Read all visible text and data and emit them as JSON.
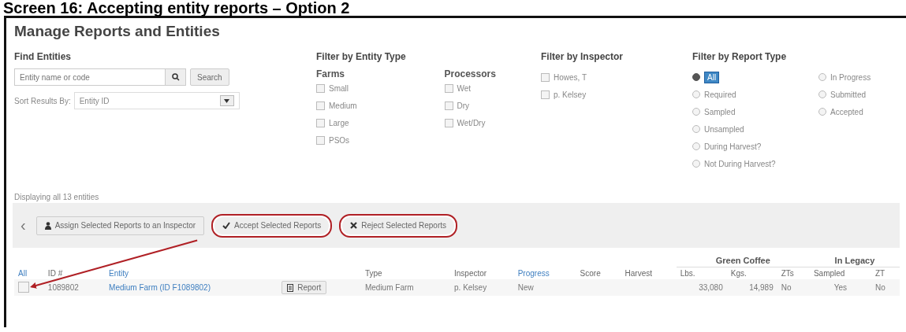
{
  "heading": "Screen 16: Accepting entity reports – Option 2",
  "page_title": "Manage Reports and Entities",
  "find": {
    "label": "Find Entities",
    "placeholder": "Entity name or code",
    "search_button": "Search",
    "sort_label": "Sort Results By:",
    "sort_value": "Entity ID",
    "count": "Displaying all 13 entities"
  },
  "entity_filter": {
    "label": "Filter by Entity Type",
    "groups": [
      {
        "label": "Farms",
        "items": [
          {
            "label": "Small",
            "checked": false
          },
          {
            "label": "Medium",
            "checked": false
          },
          {
            "label": "Large",
            "checked": false
          },
          {
            "label": "PSOs",
            "checked": false
          }
        ]
      },
      {
        "label": "Processors",
        "items": [
          {
            "label": "Wet",
            "checked": false
          },
          {
            "label": "Dry",
            "checked": false
          },
          {
            "label": "Wet/Dry",
            "checked": false
          }
        ]
      }
    ]
  },
  "inspector_filter": {
    "label": "Filter by Inspector",
    "items": [
      {
        "label": "Howes, T",
        "checked": false
      },
      {
        "label": "p. Kelsey",
        "checked": false
      }
    ]
  },
  "report_filter": {
    "label": "Filter by Report Type",
    "columns": [
      [
        {
          "label": "All",
          "selected": true
        },
        {
          "label": "Required",
          "selected": false
        },
        {
          "label": "Sampled",
          "selected": false
        },
        {
          "label": "Unsampled",
          "selected": false
        },
        {
          "label": "During Harvest?",
          "selected": false
        },
        {
          "label": "Not During Harvest?",
          "selected": false
        }
      ],
      [
        {
          "label": "In Progress",
          "selected": false
        },
        {
          "label": "Submitted",
          "selected": false
        },
        {
          "label": "Accepted",
          "selected": false
        }
      ]
    ]
  },
  "toolbar": {
    "back": "‹",
    "buttons": [
      {
        "kind": "assign",
        "label": "Assign Selected Reports to an Inspector",
        "highlighted": false
      },
      {
        "kind": "accept",
        "label": "Accept Selected Reports",
        "highlighted": true
      },
      {
        "kind": "reject",
        "label": "Reject Selected Reports",
        "highlighted": true
      }
    ]
  },
  "table": {
    "groups": [
      {
        "label": "Green Coffee"
      },
      {
        "label": "In Legacy"
      }
    ],
    "columns": [
      {
        "label": "All",
        "link": true
      },
      {
        "label": "ID #",
        "link": false
      },
      {
        "label": "Entity",
        "link": true
      },
      {},
      {
        "label": "Type",
        "link": false
      },
      {
        "label": "Inspector",
        "link": false
      },
      {
        "label": "Progress",
        "link": true
      },
      {
        "label": "Score",
        "link": false
      },
      {
        "label": "Harvest",
        "link": false
      },
      {
        "label": "Lbs.",
        "link": false
      },
      {
        "label": "Kgs.",
        "link": false
      },
      {
        "label": "ZTs",
        "link": false
      },
      {
        "label": "Sampled",
        "link": false
      },
      {
        "label": "ZT",
        "link": false
      }
    ],
    "rows": [
      {
        "checked": false,
        "id": "1089802",
        "entity": "Medium Farm (ID F1089802)",
        "report_button": "Report",
        "type": "Medium Farm",
        "inspector": "p. Kelsey",
        "progress": "New",
        "lbs": "33,080",
        "kgs": "14,989",
        "zts": "No",
        "sampled": "Yes",
        "zt": "No"
      }
    ]
  }
}
